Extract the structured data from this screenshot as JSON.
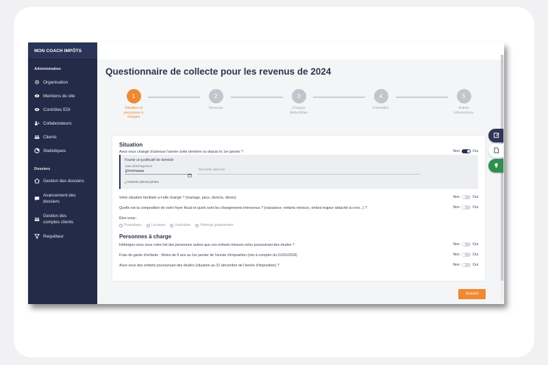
{
  "sidebar": {
    "brand": "MON COACH IMPÔTS",
    "admin_title": "Administration",
    "admin_items": [
      {
        "label": "Organisation",
        "icon": "gear-icon"
      },
      {
        "label": "Mentions du site",
        "icon": "eye-icon"
      },
      {
        "label": "Contrôles EDI",
        "icon": "eye-icon"
      },
      {
        "label": "Collaborateurs",
        "icon": "users-icon"
      },
      {
        "label": "Clients",
        "icon": "group-icon"
      },
      {
        "label": "Statistiques",
        "icon": "chart-icon"
      }
    ],
    "dossiers_title": "Dossiers",
    "dossiers_items": [
      {
        "label": "Gestion des dossiers",
        "icon": "home-icon"
      },
      {
        "label": "Avancement des dossiers",
        "icon": "chat-icon"
      },
      {
        "label": "Gestion des comptes clients",
        "icon": "group-icon"
      },
      {
        "label": "Requêteur",
        "icon": "filter-icon"
      }
    ]
  },
  "main": {
    "title": "Questionnaire de collecte pour les revenus de 2024",
    "steps": [
      {
        "number": "1",
        "label": "Situation et personnes à charges",
        "active": true
      },
      {
        "number": "2",
        "label": "Revenus",
        "active": false
      },
      {
        "number": "3",
        "label": "Charges déductibles",
        "active": false
      },
      {
        "number": "4",
        "label": "Immobilier",
        "active": false
      },
      {
        "number": "5",
        "label": "Autres informations",
        "active": false
      }
    ],
    "situation": {
      "title": "Situation",
      "q_address": "Avez-vous changé d'adresse l'année civile dernière ou depuis le 1er janvier ?",
      "justif_label": "Fournir un justificatif de domicile",
      "date_caption": "Date déménagement",
      "date_value": "jj/mm/aaaa",
      "address_placeholder": "Nouvelle adresse",
      "attach_label": "⤓ Associer pièces jointes",
      "q_family": "Votre situation familiale a-t-elle changé ? (mariage, pacs, divorce, décès)",
      "q_household": "Quelle est la composition de votre foyer fiscal et quels sont les changements intervenus ? (naissance, enfants mineurs, enfant majeur rattaché ou non...) ?",
      "status_label": "Êtes-vous :",
      "status_options": [
        "Propriétaire",
        "Locataire",
        "Usufruitier",
        "Hébergé gratuitement"
      ]
    },
    "dependents": {
      "title": "Personnes à charge",
      "q_host": "Hébergez-vous sous votre toit des personnes autres que vos enfants mineurs et/ou poursuivant des études ?",
      "q_childcare": "Frais de garde d'enfants : Moins de 6 ans au 1er janvier de l'année d'imposition (nés à compter du 01/01/2018)",
      "q_students": "Avez-vous des enfants poursuivant des études (situation au 31 décembre de l'année d'imposition) ?"
    },
    "toggle_no": "Non",
    "toggle_yes": "Oui",
    "next_label": "Suivant"
  },
  "colors": {
    "sidebar": "#232b48",
    "accent": "#ef8a33",
    "fab_dark": "#2f3657",
    "fab_green": "#2f8f4e"
  }
}
